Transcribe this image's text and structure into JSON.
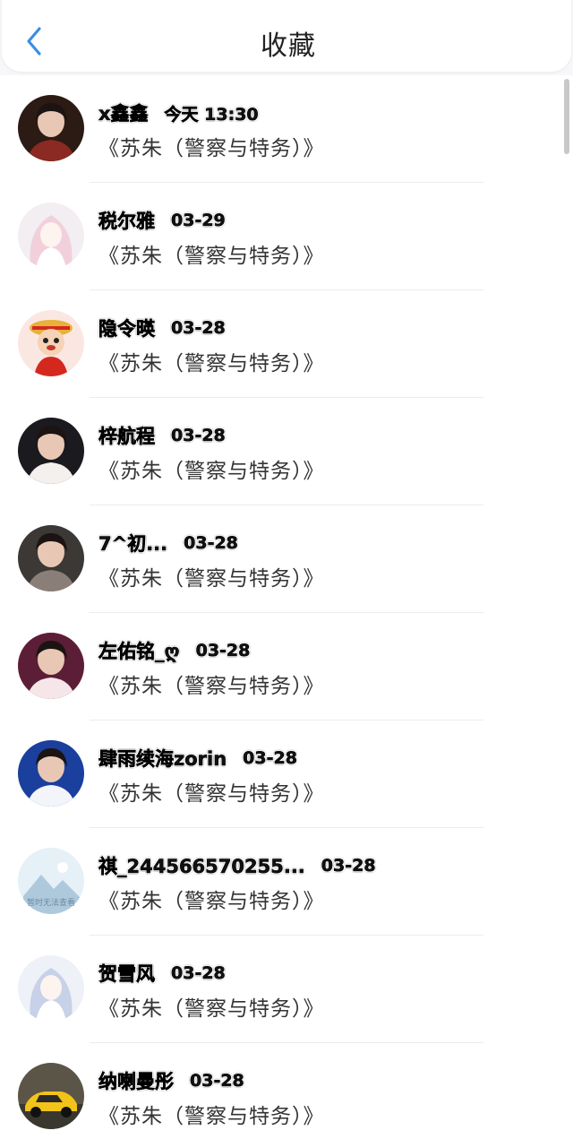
{
  "header": {
    "title": "收藏",
    "back_icon": "chevron-left-icon",
    "accent": "#3a8ee6"
  },
  "items": [
    {
      "name": "x鑫鑫",
      "date": "今天 13:30",
      "title": "《苏朱（警察与特务）》",
      "avatar": {
        "kind": "person",
        "bg": "#2b1b14",
        "accent": "#8a2a22"
      }
    },
    {
      "name": "税尔雅",
      "date": "03-29",
      "title": "《苏朱（警察与特务）》",
      "avatar": {
        "kind": "anime",
        "bg": "#f3eef2",
        "accent": "#f1b8c9"
      }
    },
    {
      "name": "隐令暎",
      "date": "03-28",
      "title": "《苏朱（警察与特务）》",
      "avatar": {
        "kind": "cartoon",
        "bg": "#fbe7e2",
        "accent": "#d4281f"
      }
    },
    {
      "name": "梓航程",
      "date": "03-28",
      "title": "《苏朱（警察与特务）》",
      "avatar": {
        "kind": "person",
        "bg": "#1a1a1f",
        "accent": "#f3f0ee"
      }
    },
    {
      "name": "7^初...",
      "date": "03-28",
      "title": "《苏朱（警察与特务）》",
      "avatar": {
        "kind": "person",
        "bg": "#3b3836",
        "accent": "#8a7f78"
      }
    },
    {
      "name": "左佑铭_ღ",
      "date": "03-28",
      "title": "《苏朱（警察与特务）》",
      "avatar": {
        "kind": "person",
        "bg": "#5c1e36",
        "accent": "#f6e6ea"
      }
    },
    {
      "name": "肆雨续海zorin",
      "date": "03-28",
      "title": "《苏朱（警察与特务）》",
      "avatar": {
        "kind": "person",
        "bg": "#1b3f9c",
        "accent": "#f3f5fb"
      }
    },
    {
      "name": "祺_244566570255...",
      "date": "03-28",
      "title": "《苏朱（警察与特务）》",
      "avatar": {
        "kind": "placeholder",
        "bg": "#e6f0f7",
        "accent": "#aec9dc",
        "caption": "暂时无法查看"
      }
    },
    {
      "name": "贺雪风",
      "date": "03-28",
      "title": "《苏朱（警察与特务）》",
      "avatar": {
        "kind": "anime",
        "bg": "#eef1f8",
        "accent": "#a7b6d9"
      }
    },
    {
      "name": "纳喇曼彤",
      "date": "03-28",
      "title": "《苏朱（警察与特务）》",
      "avatar": {
        "kind": "car",
        "bg": "#5b5548",
        "accent": "#f2c318"
      }
    }
  ]
}
